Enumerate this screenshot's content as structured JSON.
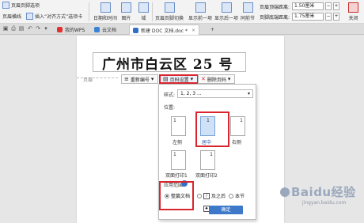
{
  "ribbon": {
    "page_header_option": "页眉页脚选项",
    "header_horizontal_line": "页眉横线",
    "insert_alignment_tab": "插入“对齐方式”选项卡",
    "date_time": "日期和时间",
    "picture": "图片",
    "field": "域",
    "header_footer_switch": "页眉页脚切换",
    "show_previous": "显示前一项",
    "show_next": "显示后一项",
    "same_as_previous": "同前节",
    "header_top_distance_label": "页眉顶端距离:",
    "header_top_distance_value": "1.50厘米",
    "footer_bottom_distance_label": "页脚底端距离:",
    "footer_bottom_distance_value": "1.75厘米",
    "close": "关闭"
  },
  "tabs": [
    {
      "label": "我的WPS",
      "color": "#e0312f"
    },
    {
      "label": "云文档",
      "color": "#3a82d6"
    },
    {
      "label": "新建 DOC 文档.doc *",
      "color": "#2f6fc7"
    }
  ],
  "document": {
    "title": "广州市白云区 25 号",
    "header_label": "页眉",
    "renumber_button": "重新编号",
    "page_number_settings_button": "页码设置",
    "delete_page_number_button": "删除页码"
  },
  "dialog": {
    "style_label": "样式:",
    "style_value": "1, 2, 3 ...",
    "position_label": "位置:",
    "positions": [
      {
        "label": "左侧",
        "num": "1"
      },
      {
        "label": "居中",
        "num": "1"
      },
      {
        "label": "右侧",
        "num": "1"
      },
      {
        "label": "双面打印1",
        "num": "1"
      },
      {
        "label": "双面打印2",
        "num": "1"
      }
    ],
    "apply_range_label": "应用范围:",
    "option_whole_doc": "整篇文档",
    "option_this_and_after": "及之后",
    "option_this_section": "本节",
    "ok_button": "确定"
  },
  "watermark": {
    "brand": "Baidu经验",
    "url": "jingyan.baidu.com"
  },
  "colors": {
    "highlight_red": "#d9252e",
    "accent_blue": "#3d78c9"
  }
}
